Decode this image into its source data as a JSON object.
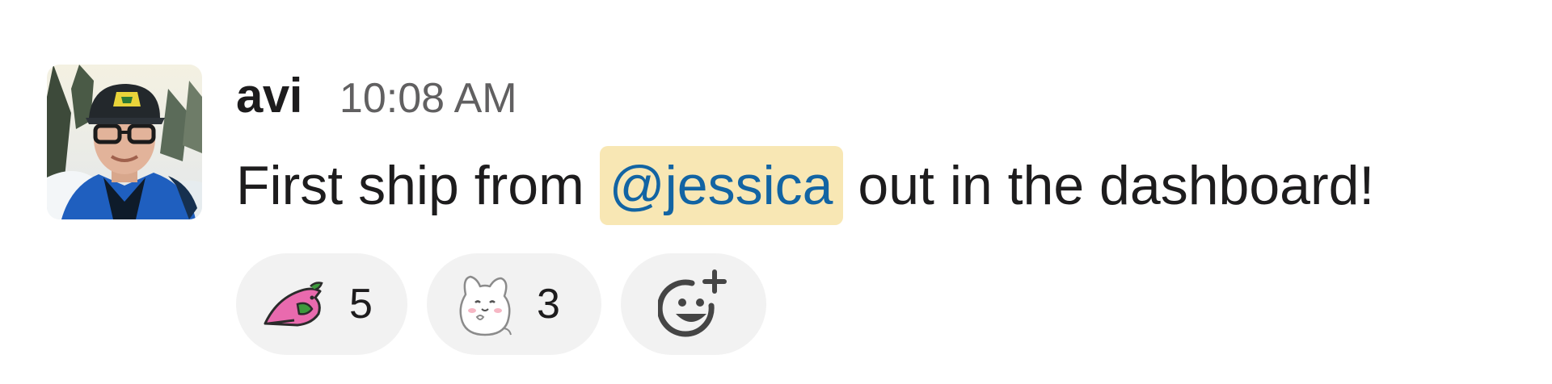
{
  "message": {
    "author": "avi",
    "timestamp": "10:08 AM",
    "text_before": "First ship from ",
    "mention": "@jessica",
    "text_after": " out in the dashboard!"
  },
  "reactions": [
    {
      "icon": "pink-bird-emoji-icon",
      "count": "5"
    },
    {
      "icon": "white-cat-emoji-icon",
      "count": "3"
    }
  ],
  "add_reaction": {
    "icon": "add-reaction-icon"
  },
  "colors": {
    "author": "#1d1c1d",
    "timestamp": "#616061",
    "mention_bg": "#f8e7b4",
    "mention_text": "#1264a3",
    "reaction_bg": "#f2f2f2"
  }
}
